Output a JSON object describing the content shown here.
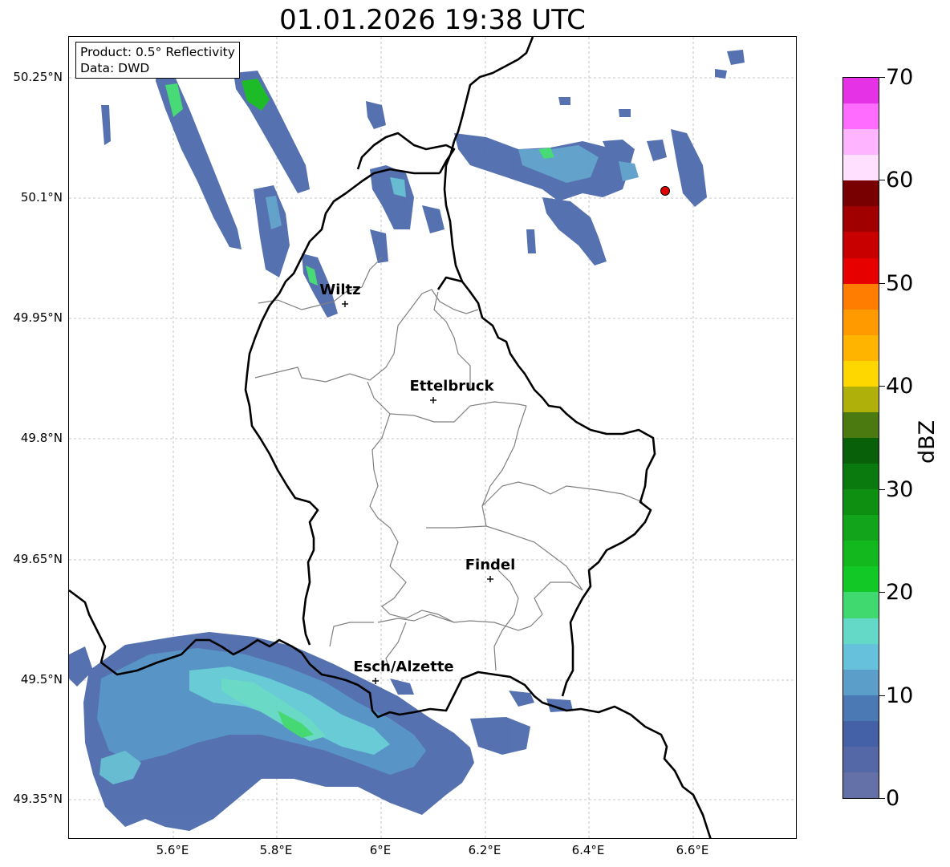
{
  "title": "01.01.2026 19:38 UTC",
  "info": {
    "product": "Product: 0.5° Reflectivity",
    "source": "Data: DWD"
  },
  "lat_labels": [
    "50.25°N",
    "50.1°N",
    "49.95°N",
    "49.8°N",
    "49.65°N",
    "49.5°N",
    "49.35°N"
  ],
  "lon_labels": [
    "5.6°E",
    "5.8°E",
    "6°E",
    "6.2°E",
    "6.4°E",
    "6.6°E"
  ],
  "cities": [
    {
      "name": "Wiltz",
      "lat": 49.97,
      "lon": 5.93
    },
    {
      "name": "Ettelbruck",
      "lat": 49.85,
      "lon": 6.1
    },
    {
      "name": "Findel",
      "lat": 49.63,
      "lon": 6.21
    },
    {
      "name": "Esch/Alzette",
      "lat": 49.5,
      "lon": 5.99
    }
  ],
  "radar_site": {
    "lat": 50.11,
    "lon": 6.55,
    "color": "#e00000"
  },
  "map_extent": {
    "lon_min": 5.4,
    "lon_max": 6.8,
    "lat_min": 49.3,
    "lat_max": 50.3
  },
  "colorbar": {
    "unit": "dBZ",
    "min": 0,
    "max": 70,
    "ticks": [
      "0",
      "10",
      "20",
      "30",
      "40",
      "50",
      "60",
      "70"
    ],
    "colors": [
      "#6371a8",
      "#5467a6",
      "#4461a8",
      "#4b79b4",
      "#5b9ec9",
      "#66c1dc",
      "#64d9c7",
      "#3fd96f",
      "#12c826",
      "#12b81e",
      "#12a41a",
      "#0f8f12",
      "#0b7a0e",
      "#086108",
      "#4a7a10",
      "#b0b00a",
      "#ffd700",
      "#ffb400",
      "#ff9b00",
      "#ff7d00",
      "#e60000",
      "#c80000",
      "#a00000",
      "#780000",
      "#ffe0ff",
      "#ffb4ff",
      "#ff6cff",
      "#e632e6"
    ]
  }
}
